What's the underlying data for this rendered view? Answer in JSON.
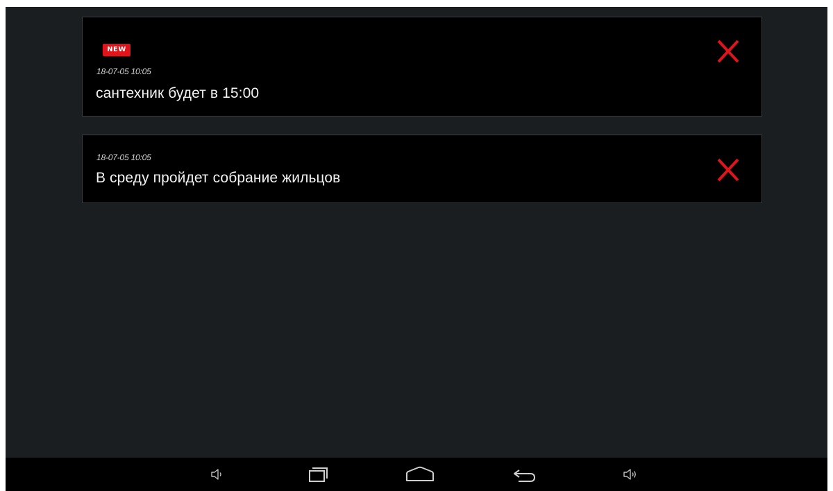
{
  "notifications": [
    {
      "badge": "NEW",
      "timestamp": "18-07-05 10:05",
      "message": "сантехник будет в 15:00"
    },
    {
      "timestamp": "18-07-05 10:05",
      "message": "В среду пройдет собрание жильцов"
    }
  ],
  "icons": {
    "close": "close-icon",
    "volume_down": "volume-down-icon",
    "recents": "recents-icon",
    "home": "home-icon",
    "back": "back-icon",
    "volume_up": "volume-up-icon"
  },
  "colors": {
    "background": "#1b1e21",
    "card": "#000000",
    "accent": "#e0141b",
    "text": "#f2f2f2"
  }
}
